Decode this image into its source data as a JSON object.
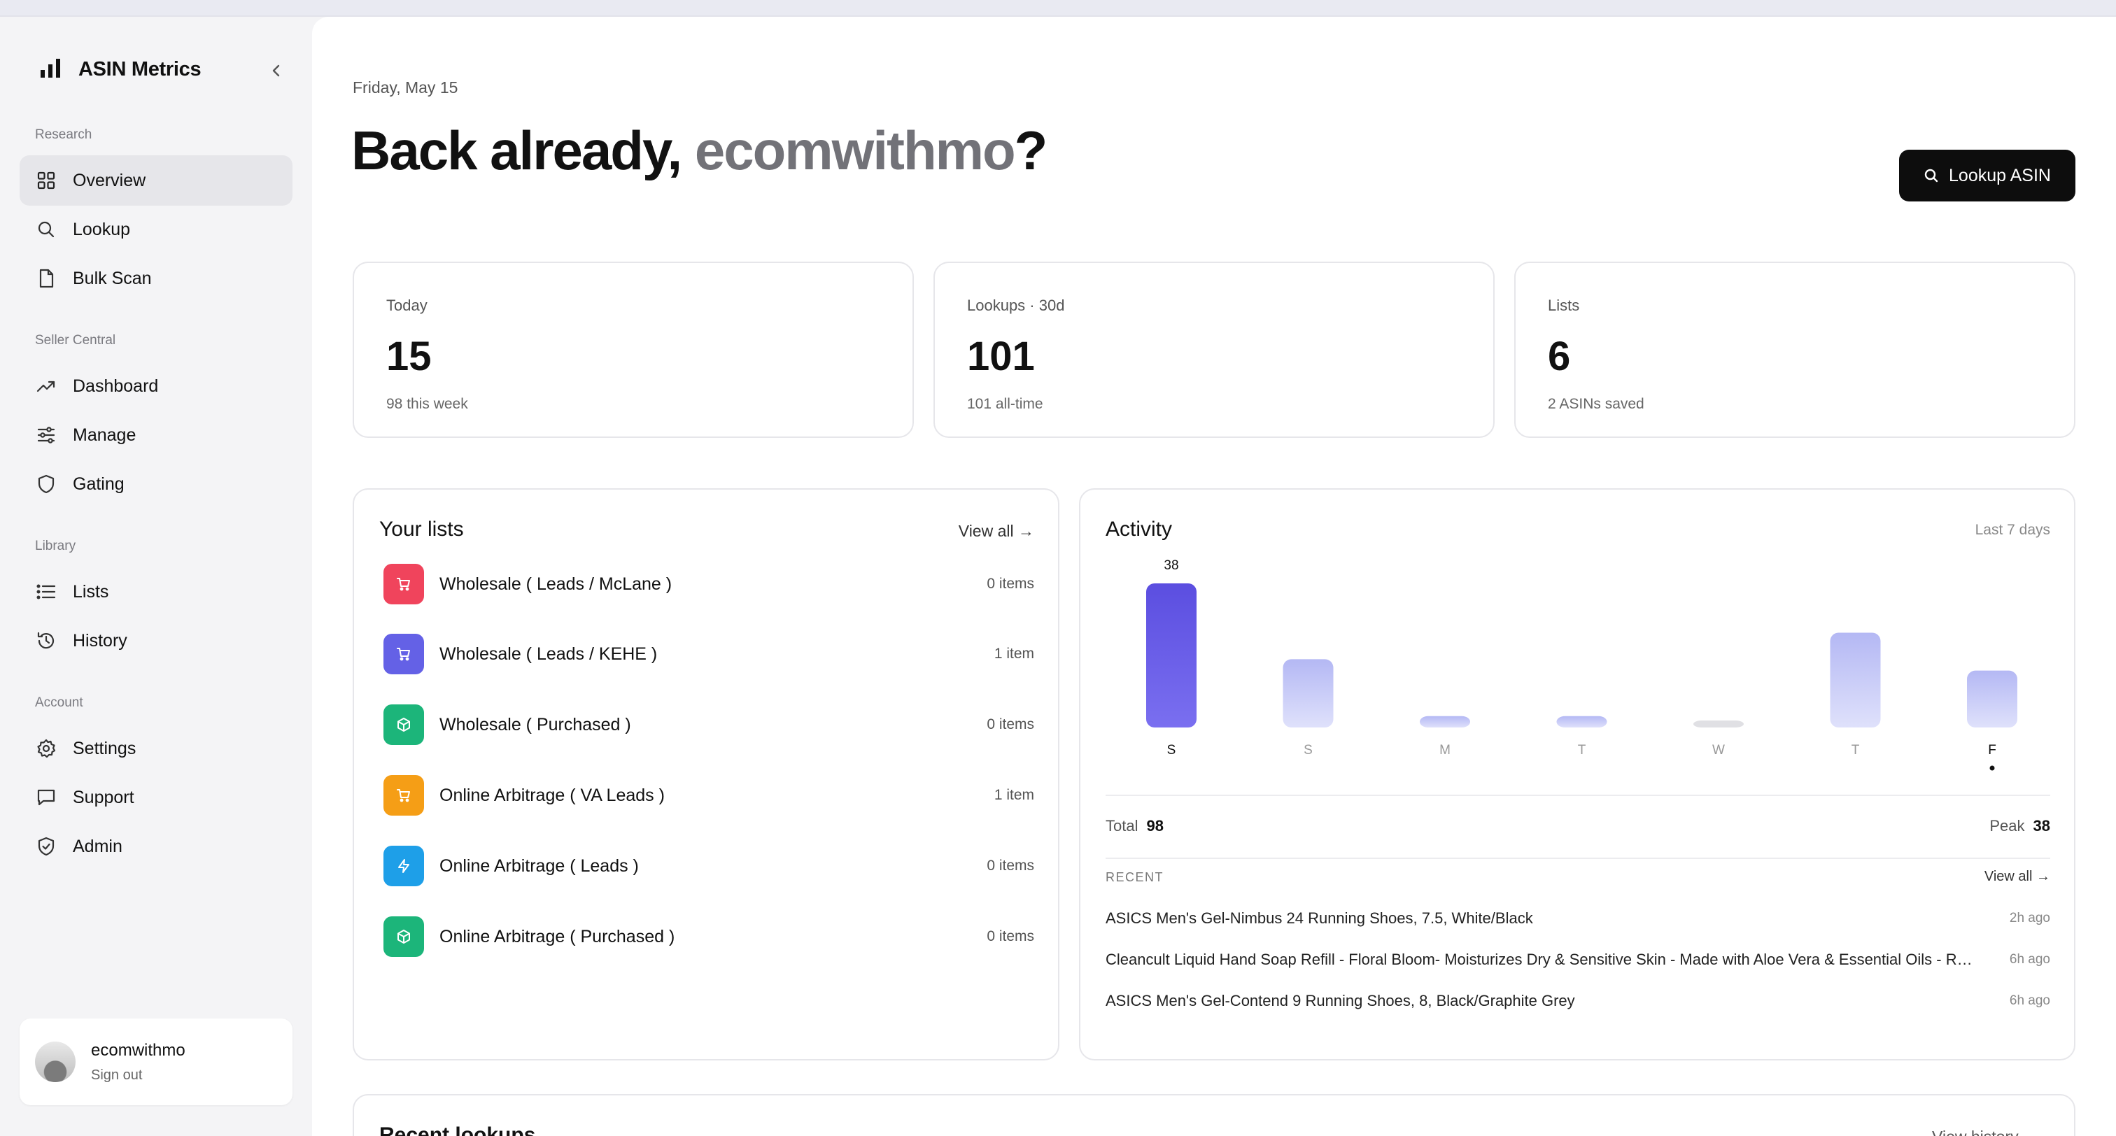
{
  "sidebar": {
    "brand": "ASIN Metrics",
    "sections": {
      "research": "Research",
      "seller_central": "Seller Central",
      "library": "Library",
      "account": "Account"
    },
    "items": {
      "overview": "Overview",
      "lookup": "Lookup",
      "bulk_scan": "Bulk Scan",
      "dashboard": "Dashboard",
      "manage": "Manage",
      "gating": "Gating",
      "lists": "Lists",
      "history": "History",
      "settings": "Settings",
      "support": "Support",
      "admin": "Admin"
    },
    "active_item": "Overview",
    "user": {
      "name": "ecomwithmo",
      "sign_out": "Sign out"
    }
  },
  "header": {
    "date": "Friday, May 15",
    "greeting_prefix": "Back already, ",
    "greeting_user": "ecomwithmo",
    "greeting_suffix": "?",
    "lookup_button": "Lookup ASIN"
  },
  "stats": [
    {
      "label": "Today",
      "value": "15",
      "sub": "98 this week"
    },
    {
      "label": "Lookups · 30d",
      "value": "101",
      "sub": "101 all-time"
    },
    {
      "label": "Lists",
      "value": "6",
      "sub": "2 ASINs saved"
    }
  ],
  "lists_panel": {
    "title": "Your lists",
    "view_all": "View all →",
    "items": [
      {
        "name": "Wholesale ( Leads / McLane )",
        "count": "0 items",
        "color": "#f0445c",
        "icon": "cart-icon"
      },
      {
        "name": "Wholesale ( Leads / KEHE )",
        "count": "1 item",
        "color": "#6461e6",
        "icon": "cart-icon"
      },
      {
        "name": "Wholesale ( Purchased )",
        "count": "0 items",
        "color": "#1cb57a",
        "icon": "box-icon"
      },
      {
        "name": "Online Arbitrage ( VA Leads )",
        "count": "1 item",
        "color": "#f59e16",
        "icon": "cart-icon"
      },
      {
        "name": "Online Arbitrage ( Leads )",
        "count": "0 items",
        "color": "#1e9fe8",
        "icon": "bolt-icon"
      },
      {
        "name": "Online Arbitrage ( Purchased )",
        "count": "0 items",
        "color": "#1cb57a",
        "icon": "box-icon"
      }
    ]
  },
  "activity": {
    "title": "Activity",
    "range": "Last 7 days",
    "total_label": "Total",
    "total_value": "98",
    "peak_label": "Peak",
    "peak_value": "38",
    "recent_label": "RECENT",
    "recent_view_all": "View all →",
    "recent": [
      {
        "title": "ASICS Men's Gel-Nimbus 24 Running Shoes, 7.5, White/Black",
        "time": "2h ago"
      },
      {
        "title": "Cleancult Liquid Hand Soap Refill - Floral Bloom- Moisturizes Dry & Sensitive Skin - Made with Aloe Vera & Essential Oils - Refill for Glass and Aluminum Dispensers",
        "time": "6h ago"
      },
      {
        "title": "ASICS Men's Gel-Contend 9 Running Shoes, 8, Black/Graphite Grey",
        "time": "6h ago"
      }
    ]
  },
  "chart_data": {
    "type": "bar",
    "categories": [
      "S",
      "S",
      "M",
      "T",
      "W",
      "T",
      "F"
    ],
    "values": [
      38,
      18,
      3,
      3,
      1,
      25,
      15
    ],
    "highlight_index": 0,
    "today_index": 6,
    "peak_label": "38",
    "ylim": [
      0,
      38
    ],
    "colors": {
      "peak": "#5b4ee0",
      "normal": "#b4b8f4",
      "empty": "#e0e0e4"
    }
  },
  "bottom": {
    "title": "Recent lookups",
    "link": "View history →"
  }
}
